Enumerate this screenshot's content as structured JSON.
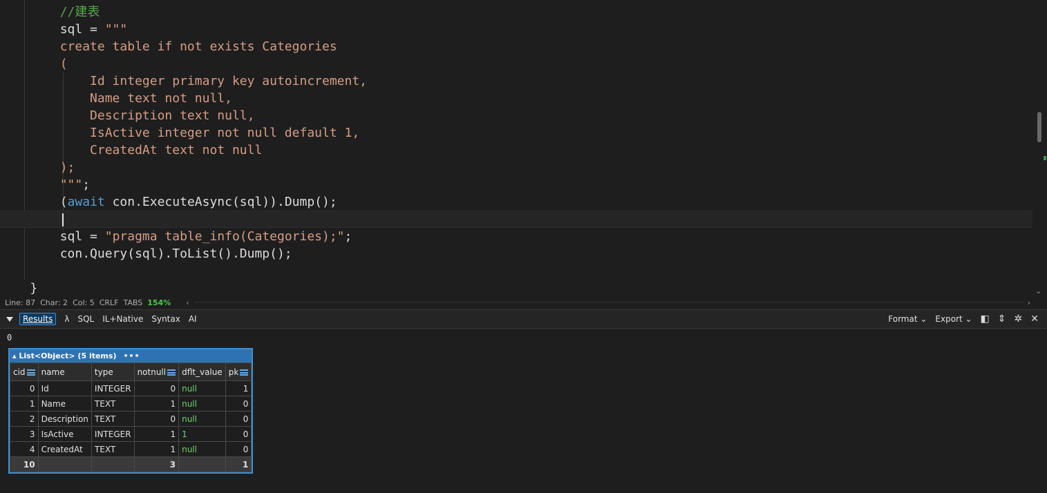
{
  "editor": {
    "lines": [
      {
        "indent": "        ",
        "parts": [
          {
            "c": "cm",
            "t": "//建表"
          }
        ]
      },
      {
        "indent": "        ",
        "parts": [
          {
            "c": "pl",
            "t": "sql = "
          },
          {
            "c": "str",
            "t": "\"\"\""
          }
        ]
      },
      {
        "indent": "        ",
        "parts": [
          {
            "c": "str",
            "t": "create table if not exists Categories"
          }
        ]
      },
      {
        "indent": "        ",
        "parts": [
          {
            "c": "str",
            "t": "("
          }
        ]
      },
      {
        "indent": "            ",
        "parts": [
          {
            "c": "str",
            "t": "Id integer primary key autoincrement,"
          }
        ]
      },
      {
        "indent": "            ",
        "parts": [
          {
            "c": "str",
            "t": "Name text not null,"
          }
        ]
      },
      {
        "indent": "            ",
        "parts": [
          {
            "c": "str",
            "t": "Description text null,"
          }
        ]
      },
      {
        "indent": "            ",
        "parts": [
          {
            "c": "str",
            "t": "IsActive integer not null default 1,"
          }
        ]
      },
      {
        "indent": "            ",
        "parts": [
          {
            "c": "str",
            "t": "CreatedAt text not null"
          }
        ]
      },
      {
        "indent": "        ",
        "parts": [
          {
            "c": "str",
            "t": ");"
          }
        ]
      },
      {
        "indent": "        ",
        "parts": [
          {
            "c": "str",
            "t": "\"\"\""
          },
          {
            "c": "pl",
            "t": ";"
          }
        ]
      },
      {
        "indent": "        ",
        "parts": [
          {
            "c": "pl",
            "t": "("
          },
          {
            "c": "kw",
            "t": "await"
          },
          {
            "c": "pl",
            "t": " con.ExecuteAsync(sql)).Dump();"
          }
        ]
      },
      {
        "indent": "",
        "parts": [],
        "current": true
      },
      {
        "indent": "        ",
        "parts": [
          {
            "c": "pl",
            "t": "sql = "
          },
          {
            "c": "str",
            "t": "\"pragma table_info(Categories);\""
          },
          {
            "c": "pl",
            "t": ";"
          }
        ]
      },
      {
        "indent": "        ",
        "parts": [
          {
            "c": "pl",
            "t": "con.Query(sql).ToList().Dump();"
          }
        ]
      },
      {
        "indent": "",
        "parts": []
      },
      {
        "indent": "    ",
        "parts": [
          {
            "c": "pl",
            "t": "}"
          }
        ]
      }
    ]
  },
  "status": {
    "line": "Line: 87",
    "char": "Char: 2",
    "col": "Col: 5",
    "eol": "CRLF",
    "tabs": "TABS",
    "zoom": "154%"
  },
  "toolbar": {
    "tabs": [
      "Results",
      "λ",
      "SQL",
      "IL+Native",
      "Syntax",
      "AI"
    ],
    "format_label": "Format ⌄",
    "export_label": "Export ⌄"
  },
  "output": {
    "scalar": "0",
    "table_title": "▴ List<Object> (5 items)",
    "table_menu": "•••",
    "columns": [
      "cid",
      "name",
      "type",
      "notnull",
      "dflt_value",
      "pk"
    ],
    "rows": [
      [
        "0",
        "Id",
        "INTEGER",
        "0",
        "null",
        "1"
      ],
      [
        "1",
        "Name",
        "TEXT",
        "1",
        "null",
        "0"
      ],
      [
        "2",
        "Description",
        "TEXT",
        "0",
        "null",
        "0"
      ],
      [
        "3",
        "IsActive",
        "INTEGER",
        "1",
        "1",
        "0"
      ],
      [
        "4",
        "CreatedAt",
        "TEXT",
        "1",
        "null",
        "0"
      ]
    ],
    "totals": [
      "10",
      "",
      "",
      "3",
      "",
      "1"
    ]
  }
}
